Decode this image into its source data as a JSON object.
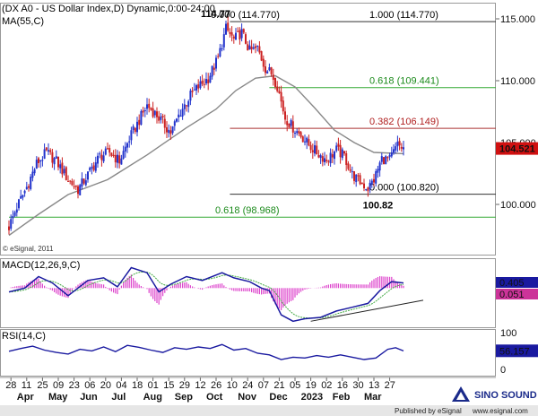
{
  "chart_data": [
    {
      "type": "candlestick",
      "title": "(DX A0 - US Dollar Index,D) Dynamic,0:00-24:00",
      "indicator_label": "MA(55,C)",
      "watermark": "© eSignal, 2011",
      "y_ticks": [
        "115.000",
        "110.000",
        "105.000",
        "100.000"
      ],
      "ylim": [
        96.5,
        116
      ],
      "last_price": "104.521",
      "price_path": [
        {
          "t": 0,
          "v": 98.2
        },
        {
          "t": 4,
          "v": 99.8
        },
        {
          "t": 9,
          "v": 101.4
        },
        {
          "t": 14,
          "v": 103.3
        },
        {
          "t": 19,
          "v": 104.2
        },
        {
          "t": 24,
          "v": 103.5
        },
        {
          "t": 30,
          "v": 102.0
        },
        {
          "t": 35,
          "v": 101.2
        },
        {
          "t": 40,
          "v": 102.4
        },
        {
          "t": 46,
          "v": 103.9
        },
        {
          "t": 51,
          "v": 104.2
        },
        {
          "t": 56,
          "v": 103.5
        },
        {
          "t": 61,
          "v": 105.3
        },
        {
          "t": 66,
          "v": 106.8
        },
        {
          "t": 70,
          "v": 108.0
        },
        {
          "t": 75,
          "v": 107.2
        },
        {
          "t": 79,
          "v": 106.4
        },
        {
          "t": 82,
          "v": 105.8
        },
        {
          "t": 87,
          "v": 107.5
        },
        {
          "t": 92,
          "v": 108.8
        },
        {
          "t": 96,
          "v": 109.5
        },
        {
          "t": 101,
          "v": 110.2
        },
        {
          "t": 106,
          "v": 111.8
        },
        {
          "t": 110,
          "v": 114.2
        },
        {
          "t": 114,
          "v": 113.3
        },
        {
          "t": 118,
          "v": 113.9
        },
        {
          "t": 122,
          "v": 112.4
        },
        {
          "t": 126,
          "v": 112.6
        },
        {
          "t": 130,
          "v": 111.0
        },
        {
          "t": 133,
          "v": 110.6
        },
        {
          "t": 136,
          "v": 109.6
        },
        {
          "t": 140,
          "v": 107.0
        },
        {
          "t": 144,
          "v": 106.2
        },
        {
          "t": 148,
          "v": 105.6
        },
        {
          "t": 152,
          "v": 104.8
        },
        {
          "t": 156,
          "v": 104.2
        },
        {
          "t": 161,
          "v": 103.6
        },
        {
          "t": 166,
          "v": 104.4
        },
        {
          "t": 170,
          "v": 103.9
        },
        {
          "t": 174,
          "v": 102.4
        },
        {
          "t": 178,
          "v": 101.8
        },
        {
          "t": 182,
          "v": 101.3
        },
        {
          "t": 185,
          "v": 102.0
        },
        {
          "t": 189,
          "v": 103.7
        },
        {
          "t": 193,
          "v": 103.6
        },
        {
          "t": 197,
          "v": 104.8
        },
        {
          "t": 200,
          "v": 104.5
        }
      ],
      "highlights": [
        {
          "label": "114.77",
          "t": 110,
          "v": 114.77
        },
        {
          "label": "100.82",
          "t": 183,
          "v": 100.82
        }
      ],
      "ma_path": [
        {
          "t": 0,
          "v": 97.5
        },
        {
          "t": 15,
          "v": 99.2
        },
        {
          "t": 30,
          "v": 100.8
        },
        {
          "t": 50,
          "v": 102.0
        },
        {
          "t": 70,
          "v": 104.0
        },
        {
          "t": 90,
          "v": 106.2
        },
        {
          "t": 105,
          "v": 107.7
        },
        {
          "t": 115,
          "v": 109.2
        },
        {
          "t": 125,
          "v": 110.2
        },
        {
          "t": 135,
          "v": 110.4
        },
        {
          "t": 145,
          "v": 109.5
        },
        {
          "t": 155,
          "v": 107.8
        },
        {
          "t": 165,
          "v": 106.0
        },
        {
          "t": 175,
          "v": 105.0
        },
        {
          "t": 185,
          "v": 104.2
        },
        {
          "t": 200,
          "v": 104.1
        }
      ],
      "levels": [
        {
          "value": 114.77,
          "label": "0.000 (114.770)",
          "label2": "1.000 (114.770)",
          "color": "#333333",
          "label_color": "#000000",
          "t_start": 112
        },
        {
          "value": 109.441,
          "label": "0.618 (109.441)",
          "color": "#33aa33",
          "label_color": "#1a8a1a",
          "t_start": 132
        },
        {
          "value": 106.149,
          "label": "0.382 (106.149)",
          "color": "#aa3333",
          "label_color": "#b02020",
          "t_start": 112
        },
        {
          "value": 100.82,
          "label": "0.000 (100.820)",
          "color": "#333333",
          "label_color": "#000000",
          "t_start": 112
        },
        {
          "value": 98.968,
          "label": "0.618 (98.968)",
          "color": "#33aa33",
          "label_color": "#1a8a1a",
          "t_start": 0
        }
      ]
    },
    {
      "type": "line",
      "indicator_label": "MACD(12,26,9,C)",
      "value_labels": [
        "0.405",
        "0.051"
      ],
      "macd_path": [
        {
          "t": 0,
          "v": -0.3
        },
        {
          "t": 8,
          "v": 0.0
        },
        {
          "t": 15,
          "v": 0.9
        },
        {
          "t": 22,
          "v": 0.4
        },
        {
          "t": 30,
          "v": -0.6
        },
        {
          "t": 40,
          "v": 0.6
        },
        {
          "t": 48,
          "v": 0.8
        },
        {
          "t": 55,
          "v": 0.1
        },
        {
          "t": 62,
          "v": 1.6
        },
        {
          "t": 70,
          "v": 1.2
        },
        {
          "t": 76,
          "v": -0.3
        },
        {
          "t": 82,
          "v": 0.3
        },
        {
          "t": 90,
          "v": 0.9
        },
        {
          "t": 98,
          "v": 0.6
        },
        {
          "t": 108,
          "v": 1.2
        },
        {
          "t": 114,
          "v": 0.8
        },
        {
          "t": 122,
          "v": 0.5
        },
        {
          "t": 128,
          "v": 0.0
        },
        {
          "t": 132,
          "v": -0.2
        },
        {
          "t": 138,
          "v": -2.1
        },
        {
          "t": 144,
          "v": -2.6
        },
        {
          "t": 150,
          "v": -2.4
        },
        {
          "t": 158,
          "v": -2.3
        },
        {
          "t": 166,
          "v": -1.8
        },
        {
          "t": 174,
          "v": -1.5
        },
        {
          "t": 182,
          "v": -1.2
        },
        {
          "t": 188,
          "v": -0.2
        },
        {
          "t": 194,
          "v": 0.5
        },
        {
          "t": 200,
          "v": 0.4
        }
      ],
      "trendline": [
        {
          "t": 153,
          "v": -2.6
        },
        {
          "t": 210,
          "v": -0.95
        }
      ],
      "ylim": [
        -3.0,
        2.2
      ]
    },
    {
      "type": "line",
      "indicator_label": "RSI(14,C)",
      "y_ticks": [
        "100",
        "0"
      ],
      "value_label": "56.157",
      "rsi_path": [
        {
          "t": 0,
          "v": 55
        },
        {
          "t": 6,
          "v": 62
        },
        {
          "t": 12,
          "v": 68
        },
        {
          "t": 18,
          "v": 58
        },
        {
          "t": 24,
          "v": 52
        },
        {
          "t": 30,
          "v": 48
        },
        {
          "t": 36,
          "v": 60
        },
        {
          "t": 42,
          "v": 56
        },
        {
          "t": 48,
          "v": 66
        },
        {
          "t": 54,
          "v": 54
        },
        {
          "t": 60,
          "v": 70
        },
        {
          "t": 66,
          "v": 65
        },
        {
          "t": 72,
          "v": 58
        },
        {
          "t": 78,
          "v": 52
        },
        {
          "t": 84,
          "v": 64
        },
        {
          "t": 90,
          "v": 60
        },
        {
          "t": 96,
          "v": 66
        },
        {
          "t": 102,
          "v": 62
        },
        {
          "t": 108,
          "v": 72
        },
        {
          "t": 114,
          "v": 58
        },
        {
          "t": 120,
          "v": 62
        },
        {
          "t": 126,
          "v": 50
        },
        {
          "t": 132,
          "v": 46
        },
        {
          "t": 138,
          "v": 34
        },
        {
          "t": 144,
          "v": 40
        },
        {
          "t": 150,
          "v": 38
        },
        {
          "t": 156,
          "v": 44
        },
        {
          "t": 162,
          "v": 40
        },
        {
          "t": 168,
          "v": 46
        },
        {
          "t": 174,
          "v": 40
        },
        {
          "t": 180,
          "v": 34
        },
        {
          "t": 186,
          "v": 38
        },
        {
          "t": 192,
          "v": 60
        },
        {
          "t": 196,
          "v": 64
        },
        {
          "t": 200,
          "v": 56
        }
      ],
      "ylim": [
        0,
        100
      ]
    }
  ],
  "x_axis": {
    "days": [
      {
        "label": "28",
        "t": 1
      },
      {
        "label": "11",
        "t": 9
      },
      {
        "label": "25",
        "t": 17
      },
      {
        "label": "09",
        "t": 25
      },
      {
        "label": "23",
        "t": 33
      },
      {
        "label": "06",
        "t": 41
      },
      {
        "label": "20",
        "t": 49
      },
      {
        "label": "04",
        "t": 57
      },
      {
        "label": "18",
        "t": 65
      },
      {
        "label": "01",
        "t": 73
      },
      {
        "label": "15",
        "t": 81
      },
      {
        "label": "29",
        "t": 89
      },
      {
        "label": "12",
        "t": 97
      },
      {
        "label": "26",
        "t": 105
      },
      {
        "label": "10",
        "t": 113
      },
      {
        "label": "24",
        "t": 121
      },
      {
        "label": "07",
        "t": 129
      },
      {
        "label": "21",
        "t": 137
      },
      {
        "label": "05",
        "t": 145
      },
      {
        "label": "19",
        "t": 153
      },
      {
        "label": "02",
        "t": 161
      },
      {
        "label": "16",
        "t": 169
      },
      {
        "label": "30",
        "t": 177
      },
      {
        "label": "13",
        "t": 185
      },
      {
        "label": "27",
        "t": 193
      }
    ],
    "months": [
      {
        "label": "Apr",
        "t": 4
      },
      {
        "label": "May",
        "t": 20
      },
      {
        "label": "Jun",
        "t": 36
      },
      {
        "label": "Jul",
        "t": 52
      },
      {
        "label": "Aug",
        "t": 68
      },
      {
        "label": "Sep",
        "t": 84
      },
      {
        "label": "Oct",
        "t": 100
      },
      {
        "label": "Nov",
        "t": 116
      },
      {
        "label": "Dec",
        "t": 132
      },
      {
        "label": "2023",
        "t": 148
      },
      {
        "label": "Feb",
        "t": 164
      },
      {
        "label": "Mar",
        "t": 180
      }
    ]
  },
  "footer": {
    "brand": "SINO SOUND",
    "published_by": "Published by eSignal",
    "website": "www.esignal.com"
  },
  "colors": {
    "up_candle": "#2233cc",
    "down_candle": "#cc2222",
    "ma_line": "#888888",
    "macd_line": "#1a1aa0",
    "macd_signal": "#44aa44",
    "macd_hist": "#dd44cc",
    "rsi_line": "#1a1aa0",
    "value_box": "#1a1aa0",
    "last_price_box": "#d01010"
  }
}
